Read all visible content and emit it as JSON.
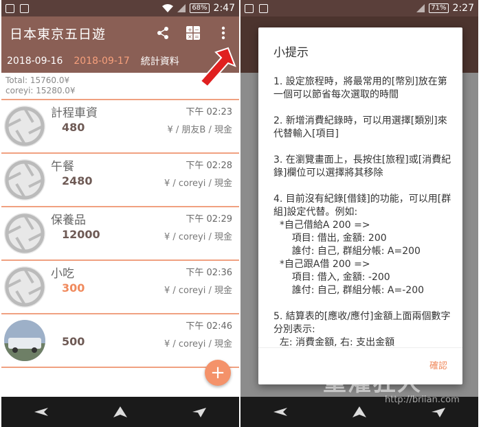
{
  "left": {
    "status": {
      "time": "2:47",
      "battery": "68%"
    },
    "app_title": "日本東京五日遊",
    "tabs": [
      "2018-09-16",
      "2018-09-17",
      "統計資料"
    ],
    "active_tab": 1,
    "totals": [
      "Total: 15760.0¥",
      "coreyi: 15280.0¥"
    ],
    "records": [
      {
        "name": "計程車資",
        "amount": "480",
        "time": "下午 02:23",
        "meta": "¥ / 朋友B / 現金",
        "highlight": false
      },
      {
        "name": "午餐",
        "amount": "2480",
        "time": "下午 02:28",
        "meta": "¥ / coreyi / 現金",
        "highlight": false
      },
      {
        "name": "保養品",
        "amount": "12000",
        "time": "下午 02:29",
        "meta": "¥ / coreyi / 現金",
        "highlight": false
      },
      {
        "name": "小吃",
        "amount": "300",
        "time": "下午 02:36",
        "meta": "¥ / coreyi / 現金",
        "highlight": true
      },
      {
        "name": "",
        "amount": "500",
        "time": "下午 02:46",
        "meta": "¥ / coreyi / 現金",
        "highlight": false
      }
    ],
    "fab_label": "+"
  },
  "right": {
    "status": {
      "time": "2:27",
      "battery": "71%"
    },
    "dialog": {
      "title": "小提示",
      "tips": [
        "1. 設定旅程時，將最常用的[幣別]放在第一個可以節省每次選取的時間",
        "2. 新增消費紀錄時，可以用選擇[類別]來代替輸入[項目]",
        "3. 在瀏覽畫面上，長按住[旅程]或[消費紀錄]欄位可以選擇將其移除",
        "4. 目前沒有紀錄[借錢]的功能，可以用[群組]設定代替。例如:\n  *自己借給A 200 =>\n      項目: 借出, 金額: 200\n      誰付: 自己, 群組分帳: A=200\n  *自己跟A借 200 =>\n      項目: 借入, 金額: -200\n      誰付: 自己, 群組分帳: A=-200",
        "5. 結算表的[應收/應付]金額上面兩個數字分別表示:\n  左: 消費金額, 右: 支出金額"
      ],
      "confirm_label": "確認"
    }
  },
  "watermark": {
    "text": "重灌狂人",
    "url": "http://briian.com"
  },
  "colors": {
    "toolbar": "#8a5f55",
    "statusbar": "#5a3f3a",
    "accent": "#f08a5d",
    "divider": "#f0a080"
  }
}
